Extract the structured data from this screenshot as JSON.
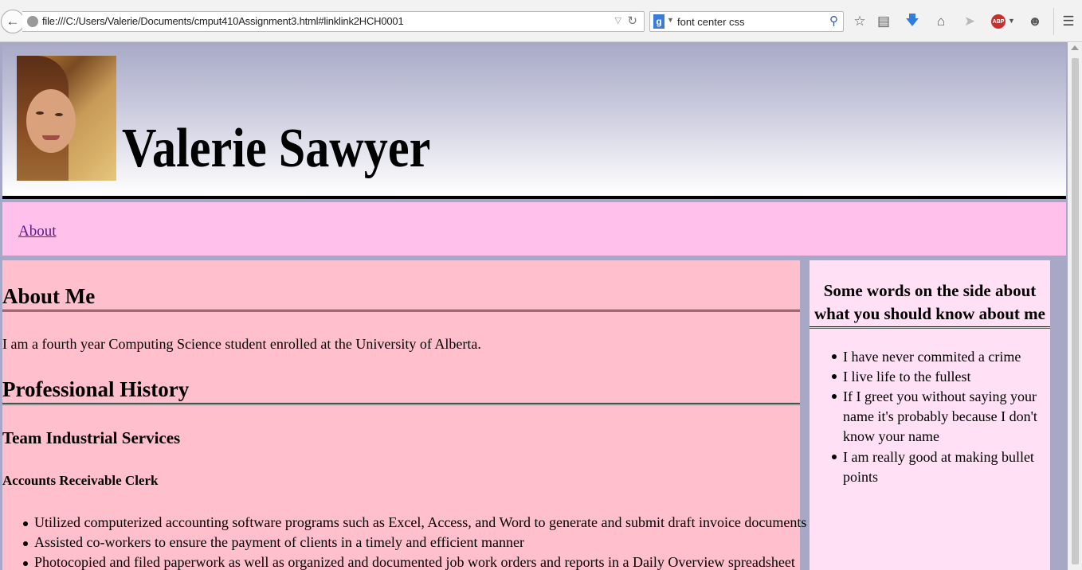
{
  "browser": {
    "url": "file:///C:/Users/Valerie/Documents/cmput410Assignment3.html#linklink2HCH0001",
    "search_query": "font center css",
    "search_engine_icon": "google-g-icon",
    "adblock_label": "ABP"
  },
  "page": {
    "header": {
      "title": "Valerie Sawyer"
    },
    "nav": {
      "items": [
        {
          "label": "About"
        }
      ]
    },
    "main": {
      "about_heading": "About Me",
      "about_text": "I am a fourth year Computing Science student enrolled at the University of Alberta.",
      "history_heading": "Professional History",
      "company": "Team Industrial Services",
      "role": "Accounts Receivable Clerk",
      "duties": [
        "Utilized computerized accounting software programs such as Excel, Access, and Word to generate and submit draft invoice documents",
        "Assisted co-workers to ensure the payment of clients in a timely and efficient manner",
        "Photocopied and filed paperwork as well as organized and documented job work orders and reports in a Daily Overview spreadsheet"
      ]
    },
    "aside": {
      "title": "Some words on the side about what you should know about me",
      "items": [
        "I have never commited a crime",
        "I live life to the fullest",
        "If I greet you without saying your name it's probably because I don't know your name",
        "I am really good at making bullet points"
      ]
    }
  },
  "colors": {
    "page_bg": "#a7a8c5",
    "nav_bg": "#ffc0eb",
    "main_bg": "#ffbfcc",
    "aside_bg": "#ffe0f4",
    "link": "#551a8b"
  }
}
